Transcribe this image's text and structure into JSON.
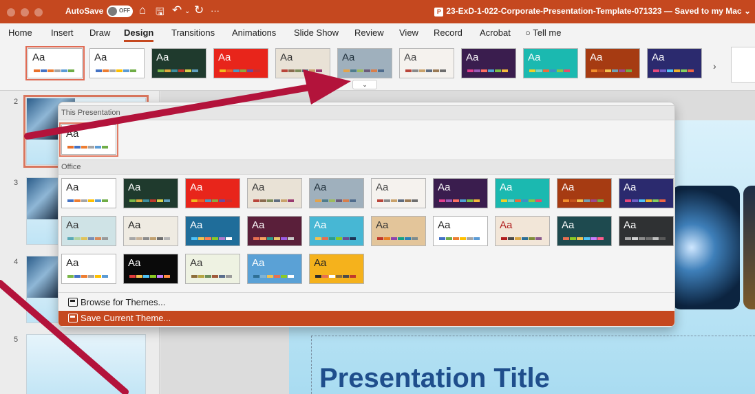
{
  "titlebar": {
    "autosave_label": "AutoSave",
    "autosave_state": "OFF",
    "document_title": "23-ExD-1-022-Corporate-Presentation-Template-071323 — Saved to my Mac",
    "more_label": "···"
  },
  "menu": {
    "tabs": [
      "Home",
      "Insert",
      "Draw",
      "Design",
      "Transitions",
      "Animations",
      "Slide Show",
      "Review",
      "View",
      "Record",
      "Acrobat",
      "Tell me"
    ],
    "active_tab": "Design"
  },
  "ribbon": {
    "theme_sample_text": "Aa",
    "themes": [
      {
        "theme": "current-white",
        "bg": "#ffffff",
        "fg": "#222222",
        "accent": [
          "#e8712b",
          "#4472c4",
          "#ed7d31",
          "#a5a5a5",
          "#5b9bd5",
          "#70ad47"
        ]
      },
      {
        "theme": "office",
        "bg": "#ffffff",
        "fg": "#222222",
        "accent": [
          "#4472c4",
          "#ed7d31",
          "#a5a5a5",
          "#ffc000",
          "#5b9bd5",
          "#70ad47"
        ]
      },
      {
        "theme": "green-dark",
        "bg": "#1f3a2d",
        "fg": "#ffffff",
        "accent": [
          "#7ab648",
          "#e0a93c",
          "#3d8e9e",
          "#c0392b",
          "#d9d24c",
          "#60a0c0"
        ]
      },
      {
        "theme": "red-banner",
        "bg": "#e8251b",
        "fg": "#ffffff",
        "accent": [
          "#f0b91b",
          "#f15a22",
          "#4c9ac2",
          "#8aa640",
          "#6b4a9e",
          "#c72f2f"
        ]
      },
      {
        "theme": "beige",
        "bg": "#e9e2d6",
        "fg": "#333333",
        "accent": [
          "#b9453a",
          "#8a6b4e",
          "#7d8c5a",
          "#5f6d80",
          "#c9a26b",
          "#9a3a6f"
        ]
      },
      {
        "theme": "gray-blue",
        "bg": "#9fb0bd",
        "fg": "#1f2f3a",
        "accent": [
          "#e3a34a",
          "#4e7c8c",
          "#9dbb5e",
          "#6b5a7a",
          "#d97e4a",
          "#4e6b8c"
        ]
      },
      {
        "theme": "stamp",
        "bg": "#f5f2ee",
        "fg": "#444444",
        "accent": [
          "#b9453a",
          "#8a8a8a",
          "#c9a26b",
          "#5f6d80",
          "#9a7a55",
          "#6e6e6e"
        ]
      },
      {
        "theme": "purple",
        "bg": "#3a1d4e",
        "fg": "#ffffff",
        "accent": [
          "#e23d8c",
          "#9b59b6",
          "#ff6f61",
          "#4fa3d1",
          "#7bc043",
          "#f6b93b"
        ]
      },
      {
        "theme": "teal",
        "bg": "#1bb9b0",
        "fg": "#ffffff",
        "accent": [
          "#f2d024",
          "#7bd3c8",
          "#ee6a3b",
          "#3e8ec7",
          "#8ec641",
          "#e84b6a"
        ]
      },
      {
        "theme": "orange-dark",
        "bg": "#a63b12",
        "fg": "#ffffff",
        "accent": [
          "#f18d2b",
          "#c6531c",
          "#f2c14e",
          "#6fa0b4",
          "#9c4a8f",
          "#70ad47"
        ]
      },
      {
        "theme": "indigo",
        "bg": "#2b2a6e",
        "fg": "#ffffff",
        "accent": [
          "#e6477b",
          "#6e5ec7",
          "#4fc3f7",
          "#f0b429",
          "#85d05e",
          "#f06543"
        ]
      }
    ]
  },
  "gallery": {
    "section_this": "This Presentation",
    "section_office": "Office",
    "theme_sample_text": "Aa",
    "this_presentation": [
      {
        "theme": "current",
        "bg": "#ffffff",
        "fg": "#222222",
        "accent": [
          "#e8712b",
          "#4472c4",
          "#ed7d31",
          "#a5a5a5",
          "#5b9bd5",
          "#70ad47"
        ]
      }
    ],
    "office_themes": [
      {
        "theme": "office",
        "bg": "#ffffff",
        "fg": "#222222",
        "accent": [
          "#4472c4",
          "#ed7d31",
          "#a5a5a5",
          "#ffc000",
          "#5b9bd5",
          "#70ad47"
        ]
      },
      {
        "theme": "green-dark",
        "bg": "#1f3a2d",
        "fg": "#ffffff",
        "accent": [
          "#7ab648",
          "#e0a93c",
          "#3d8e9e",
          "#c0392b",
          "#d9d24c",
          "#60a0c0"
        ]
      },
      {
        "theme": "red-banner",
        "bg": "#e8251b",
        "fg": "#ffffff",
        "accent": [
          "#f0b91b",
          "#f15a22",
          "#4c9ac2",
          "#8aa640",
          "#6b4a9e",
          "#c72f2f"
        ]
      },
      {
        "theme": "beige",
        "bg": "#e9e2d6",
        "fg": "#333333",
        "accent": [
          "#b9453a",
          "#8a6b4e",
          "#7d8c5a",
          "#5f6d80",
          "#c9a26b",
          "#9a3a6f"
        ]
      },
      {
        "theme": "gray-blue",
        "bg": "#9fb0bd",
        "fg": "#1f2f3a",
        "accent": [
          "#e3a34a",
          "#4e7c8c",
          "#9dbb5e",
          "#6b5a7a",
          "#d97e4a",
          "#4e6b8c"
        ]
      },
      {
        "theme": "stamp",
        "bg": "#f5f2ee",
        "fg": "#444444",
        "accent": [
          "#b9453a",
          "#8a8a8a",
          "#c9a26b",
          "#5f6d80",
          "#9a7a55",
          "#6e6e6e"
        ]
      },
      {
        "theme": "purple",
        "bg": "#3a1d4e",
        "fg": "#ffffff",
        "accent": [
          "#e23d8c",
          "#9b59b6",
          "#ff6f61",
          "#4fa3d1",
          "#7bc043",
          "#f6b93b"
        ]
      },
      {
        "theme": "teal",
        "bg": "#1bb9b0",
        "fg": "#ffffff",
        "accent": [
          "#f2d024",
          "#7bd3c8",
          "#ee6a3b",
          "#3e8ec7",
          "#8ec641",
          "#e84b6a"
        ]
      },
      {
        "theme": "orange-dark",
        "bg": "#a63b12",
        "fg": "#ffffff",
        "accent": [
          "#f18d2b",
          "#c6531c",
          "#f2c14e",
          "#6fa0b4",
          "#9c4a8f",
          "#70ad47"
        ]
      },
      {
        "theme": "indigo",
        "bg": "#2b2a6e",
        "fg": "#ffffff",
        "accent": [
          "#e6477b",
          "#6e5ec7",
          "#4fc3f7",
          "#f0b429",
          "#85d05e",
          "#f06543"
        ]
      },
      {
        "theme": "pattern-teal",
        "bg": "#cfe3e6",
        "fg": "#333333",
        "accent": [
          "#5aa9b5",
          "#b2d3a0",
          "#e0c35a",
          "#7a8fb5",
          "#d98a5a",
          "#9a9a9a"
        ]
      },
      {
        "theme": "frame",
        "bg": "#efebe2",
        "fg": "#222222",
        "accent": [
          "#a6a6a6",
          "#c7b299",
          "#8c8c8c",
          "#c0a070",
          "#6e6e6e",
          "#b5b5b5"
        ]
      },
      {
        "theme": "blue-wave",
        "bg": "#1f6d9a",
        "fg": "#ffffff",
        "accent": [
          "#4fc3f7",
          "#f2c14e",
          "#ff7f50",
          "#8ac926",
          "#b07acc",
          "#ffffff"
        ]
      },
      {
        "theme": "wine",
        "bg": "#5a1f3a",
        "fg": "#ffffff",
        "accent": [
          "#e76f51",
          "#f4a261",
          "#2a9d8f",
          "#e9c46a",
          "#9b5de5",
          "#c9c9c9"
        ]
      },
      {
        "theme": "aqua-block",
        "bg": "#47b7d4",
        "fg": "#ffffff",
        "accent": [
          "#f2c14e",
          "#e76f51",
          "#2a9d8f",
          "#8ac926",
          "#6a4c93",
          "#1d3557"
        ]
      },
      {
        "theme": "wood",
        "bg": "#e3c59a",
        "fg": "#333333",
        "accent": [
          "#c0392b",
          "#e67e22",
          "#8e44ad",
          "#16a085",
          "#2980b9",
          "#7f8c8d"
        ]
      },
      {
        "theme": "light-gray",
        "bg": "#ffffff",
        "fg": "#222222",
        "accent": [
          "#4472c4",
          "#70ad47",
          "#ed7d31",
          "#ffc000",
          "#a5a5a5",
          "#5b9bd5"
        ]
      },
      {
        "theme": "red-photo",
        "bg": "#f2e6d8",
        "fg": "#b01e1e",
        "accent": [
          "#b01e1e",
          "#4a4a4a",
          "#d9a441",
          "#2e6f95",
          "#7f8c3a",
          "#8a5a8c"
        ]
      },
      {
        "theme": "dark-teal",
        "bg": "#1e4a4f",
        "fg": "#ffffff",
        "accent": [
          "#e76f51",
          "#8ac926",
          "#f2c14e",
          "#4fc3f7",
          "#c77dff",
          "#ff5d8f"
        ]
      },
      {
        "theme": "charcoal",
        "bg": "#2f3133",
        "fg": "#ffffff",
        "accent": [
          "#a5a5a5",
          "#d4d4d4",
          "#8c8c8c",
          "#6e6e6e",
          "#bfbfbf",
          "#5a5a5a"
        ]
      },
      {
        "theme": "green-chevron",
        "bg": "#ffffff",
        "fg": "#222222",
        "accent": [
          "#7ab648",
          "#4472c4",
          "#ed7d31",
          "#a5a5a5",
          "#ffc000",
          "#5b9bd5"
        ]
      },
      {
        "theme": "black-wave",
        "bg": "#0a0a0a",
        "fg": "#ffffff",
        "accent": [
          "#e23d3d",
          "#f2c14e",
          "#4fc3f7",
          "#8ac926",
          "#c77dff",
          "#ff8c42"
        ]
      },
      {
        "theme": "sage",
        "bg": "#eef2e2",
        "fg": "#333333",
        "accent": [
          "#8c6d3a",
          "#b5a642",
          "#6a8d5a",
          "#a05a3a",
          "#5a6d8c",
          "#9a9a9a"
        ]
      },
      {
        "theme": "blue-pattern",
        "bg": "#5aa1d6",
        "fg": "#ffffff",
        "accent": [
          "#2e6f95",
          "#7fb3d5",
          "#f2c14e",
          "#e76f51",
          "#8ac926",
          "#ffffff"
        ]
      },
      {
        "theme": "yellow",
        "bg": "#f5b21c",
        "fg": "#222222",
        "accent": [
          "#2b2b2b",
          "#e76f51",
          "#ffffff",
          "#8c6d3a",
          "#4a4a4a",
          "#c0392b"
        ]
      }
    ],
    "menu_items": [
      {
        "label": "Browse for Themes...",
        "icon": "browse-themes-icon"
      },
      {
        "label": "Save Current Theme...",
        "icon": "save-theme-icon"
      }
    ]
  },
  "slides": {
    "numbers": [
      "2",
      "3",
      "4",
      "5"
    ]
  },
  "main_slide": {
    "title": "Presentation Title"
  },
  "colors": {
    "accent": "#c5481f",
    "annotation_arrow": "#b3133b"
  }
}
